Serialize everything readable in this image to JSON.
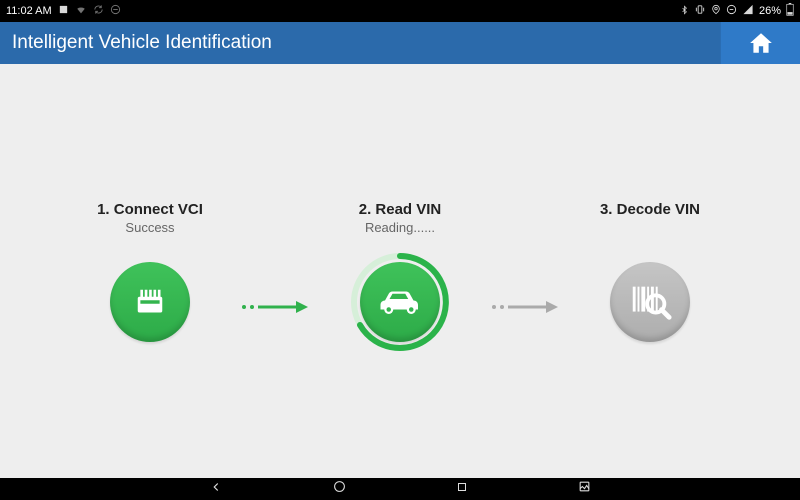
{
  "statusbar": {
    "time": "11:02 AM",
    "battery_pct": "26%"
  },
  "titlebar": {
    "title": "Intelligent Vehicle Identification"
  },
  "steps": {
    "s1": {
      "title": "1. Connect VCI",
      "sub": "Success"
    },
    "s2": {
      "title": "2. Read VIN",
      "sub": "Reading......"
    },
    "s3": {
      "title": "3. Decode VIN",
      "sub": ""
    }
  }
}
